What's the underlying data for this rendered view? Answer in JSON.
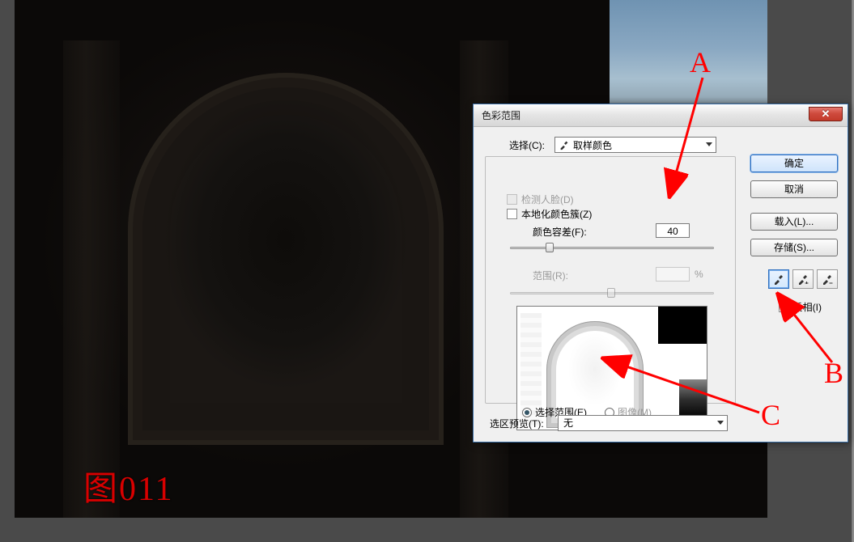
{
  "caption": "图011",
  "dialog": {
    "title": "色彩范围",
    "select_label": "选择(C):",
    "select_value": "取样颜色",
    "detect_faces": "检测人脸(D)",
    "localized": "本地化颜色簇(Z)",
    "fuzziness_label": "颜色容差(F):",
    "fuzziness_value": "40",
    "range_label": "范围(R):",
    "percent": "%",
    "radio_selection": "选择范围(E)",
    "radio_image": "图像(M)",
    "preview_label": "选区预览(T):",
    "preview_value": "无",
    "invert_label": "反相(I)"
  },
  "buttons": {
    "ok": "确定",
    "cancel": "取消",
    "load": "载入(L)...",
    "save": "存储(S)..."
  },
  "annotations": {
    "a": "A",
    "b": "B",
    "c": "C"
  }
}
